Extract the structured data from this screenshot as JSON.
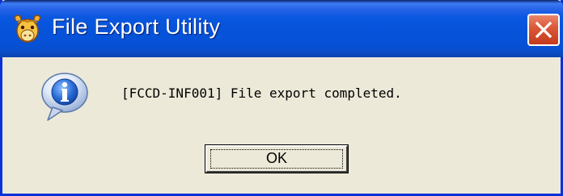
{
  "window": {
    "title": "File Export Utility",
    "app_icon": "sheep-icon",
    "close_icon": "close-icon"
  },
  "dialog": {
    "icon": "info-icon",
    "message": "[FCCD-INF001] File export completed.",
    "ok_label": "OK"
  },
  "colors": {
    "titlebar_blue": "#0653da",
    "close_red": "#dc5a3a",
    "dialog_bg": "#ece9d8",
    "info_blue": "#2a6bd6"
  }
}
